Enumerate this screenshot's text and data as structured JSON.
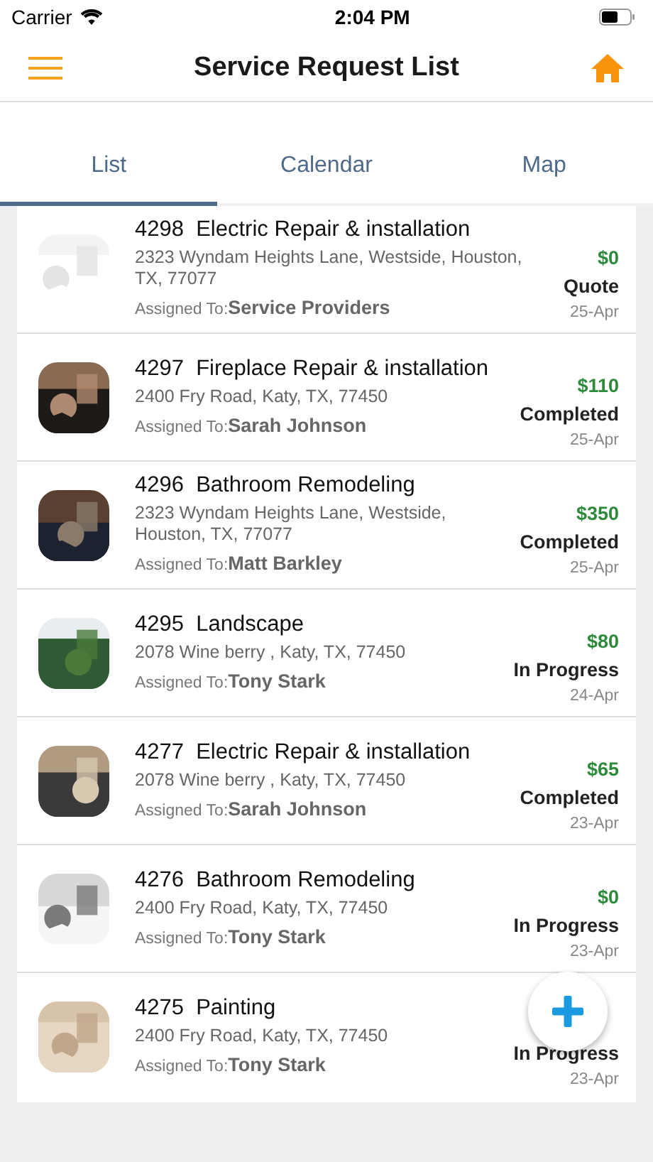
{
  "status_bar": {
    "carrier": "Carrier",
    "time": "2:04 PM"
  },
  "nav": {
    "title": "Service Request List"
  },
  "tabs": [
    {
      "label": "List",
      "selected": true
    },
    {
      "label": "Calendar",
      "selected": false
    },
    {
      "label": "Map",
      "selected": false
    }
  ],
  "requests": [
    {
      "number": "4298",
      "service": "Electric Repair & installation",
      "address": "2323 Wyndam Heights Lane, Westside, Houston, TX, 77077",
      "assigned_label": "Assigned To:",
      "assignee": "Service Providers",
      "price": "$0",
      "status": "Quote",
      "date": "25-Apr"
    },
    {
      "number": "4297",
      "service": "Fireplace Repair & installation",
      "address": "2400 Fry Road, Katy, TX, 77450",
      "assigned_label": "Assigned To:",
      "assignee": "Sarah Johnson",
      "price": "$110",
      "status": "Completed",
      "date": "25-Apr"
    },
    {
      "number": "4296",
      "service": "Bathroom Remodeling",
      "address": "2323 Wyndam Heights Lane, Westside, Houston, TX, 77077",
      "assigned_label": "Assigned To:",
      "assignee": "Matt Barkley",
      "price": "$350",
      "status": "Completed",
      "date": "25-Apr"
    },
    {
      "number": "4295",
      "service": "Landscape",
      "address": "2078 Wine berry , Katy, TX, 77450",
      "assigned_label": "Assigned To:",
      "assignee": "Tony Stark",
      "price": "$80",
      "status": "In Progress",
      "date": "24-Apr"
    },
    {
      "number": "4277",
      "service": "Electric Repair & installation",
      "address": "2078 Wine berry , Katy, TX, 77450",
      "assigned_label": "Assigned To:",
      "assignee": "Sarah Johnson",
      "price": "$65",
      "status": "Completed",
      "date": "23-Apr"
    },
    {
      "number": "4276",
      "service": "Bathroom Remodeling",
      "address": "2400 Fry Road, Katy, TX, 77450",
      "assigned_label": "Assigned To:",
      "assignee": "Tony Stark",
      "price": "$0",
      "status": "In Progress",
      "date": "23-Apr"
    },
    {
      "number": "4275",
      "service": "Painting",
      "address": "2400 Fry Road, Katy, TX, 77450",
      "assigned_label": "Assigned To:",
      "assignee": "Tony Stark",
      "status": "In Progress",
      "date": "23-Apr"
    }
  ]
}
